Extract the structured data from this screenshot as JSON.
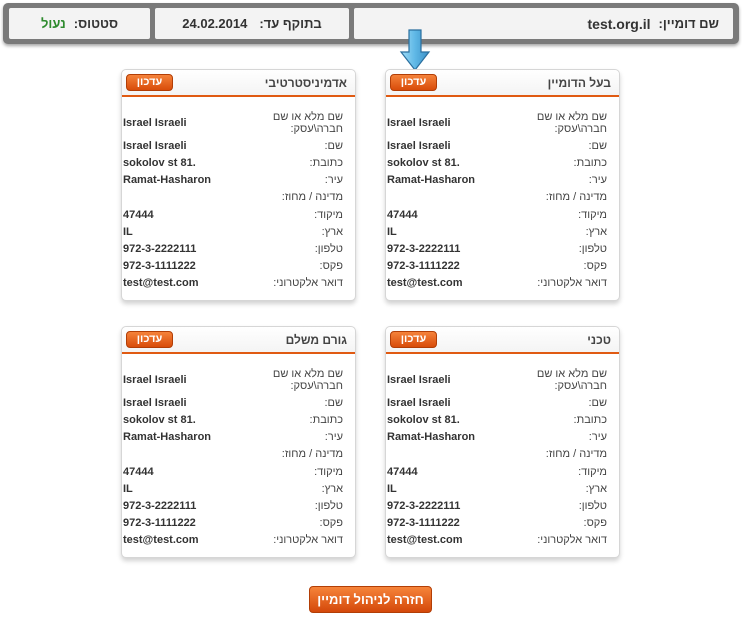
{
  "header": {
    "domain_label": "שם דומיין:",
    "domain_value": "test.org.il",
    "expiry_label": "בתוקף עד:",
    "expiry_value": "24.02.2014",
    "status_label": "סטטוס:",
    "status_value": "נעול"
  },
  "colors": {
    "accent": "#e05a12",
    "status_ok": "#2e8b2e",
    "arrow": "#5fb8e6"
  },
  "update_label": "עדכון",
  "field_labels": {
    "fullname": "שם מלא או שם חברה\\עסק:",
    "name": "שם:",
    "address": "כתובת:",
    "city": "עיר:",
    "state": "מדינה / מחוז:",
    "zip": "מיקוד:",
    "country": "ארץ:",
    "phone": "טלפון:",
    "fax": "פקס:",
    "email": "דואר אלקטרוני:"
  },
  "cards": [
    {
      "title": "בעל הדומיין",
      "fullname": "Israel Israeli",
      "name": "Israel Israeli",
      "address": "sokolov st 81.",
      "city": "Ramat-Hasharon",
      "state": "",
      "zip": "47444",
      "country": "IL",
      "phone": "972-3-2222111",
      "fax": "972-3-1111222",
      "email": "test@test.com"
    },
    {
      "title": "אדמיניסטרטיבי",
      "fullname": "Israel Israeli",
      "name": "Israel Israeli",
      "address": "sokolov st 81.",
      "city": "Ramat-Hasharon",
      "state": "",
      "zip": "47444",
      "country": "IL",
      "phone": "972-3-2222111",
      "fax": "972-3-1111222",
      "email": "test@test.com"
    },
    {
      "title": "טכני",
      "fullname": "Israel Israeli",
      "name": "Israel Israeli",
      "address": "sokolov st 81.",
      "city": "Ramat-Hasharon",
      "state": "",
      "zip": "47444",
      "country": "IL",
      "phone": "972-3-2222111",
      "fax": "972-3-1111222",
      "email": "test@test.com"
    },
    {
      "title": "גורם משלם",
      "fullname": "Israel Israeli",
      "name": "Israel Israeli",
      "address": "sokolov st 81.",
      "city": "Ramat-Hasharon",
      "state": "",
      "zip": "47444",
      "country": "IL",
      "phone": "972-3-2222111",
      "fax": "972-3-1111222",
      "email": "test@test.com"
    }
  ],
  "back_button": "חזרה לניהול דומיין"
}
